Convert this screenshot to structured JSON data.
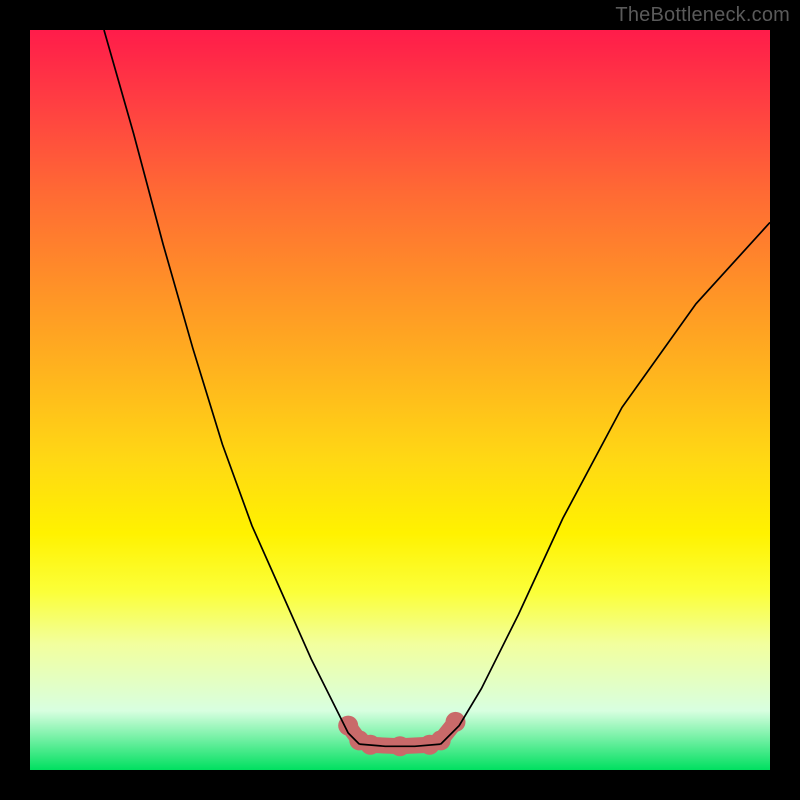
{
  "attribution": "TheBottleneck.com",
  "chart_data": {
    "type": "line",
    "title": "",
    "xlabel": "",
    "ylabel": "",
    "xlim": [
      0,
      100
    ],
    "ylim": [
      0,
      100
    ],
    "note": "Axes are unlabeled; values are estimated from pixel positions as percentages of the plot area (x left→right, y bottom→top).",
    "series": [
      {
        "name": "left-curve",
        "x": [
          10,
          14,
          18,
          22,
          26,
          30,
          34,
          38,
          41,
          43,
          44.5
        ],
        "y": [
          100,
          86,
          71,
          57,
          44,
          33,
          24,
          15,
          9,
          5,
          3.5
        ]
      },
      {
        "name": "right-curve",
        "x": [
          55.5,
          58,
          61,
          66,
          72,
          80,
          90,
          100
        ],
        "y": [
          3.5,
          6,
          11,
          21,
          34,
          49,
          63,
          74
        ]
      },
      {
        "name": "bottom-flat",
        "x": [
          44.5,
          48,
          52,
          55.5
        ],
        "y": [
          3.5,
          3.2,
          3.2,
          3.5
        ]
      }
    ],
    "markers": [
      {
        "x": 43.0,
        "y": 6.0
      },
      {
        "x": 44.5,
        "y": 4.0
      },
      {
        "x": 46.0,
        "y": 3.4
      },
      {
        "x": 50.0,
        "y": 3.2
      },
      {
        "x": 54.0,
        "y": 3.4
      },
      {
        "x": 55.5,
        "y": 4.0
      },
      {
        "x": 57.5,
        "y": 6.5
      }
    ],
    "colors": {
      "background_top": "#ff1c4a",
      "background_bottom": "#00e060",
      "curve": "#000000",
      "markers": "#c96a6a",
      "frame": "#000000"
    }
  }
}
